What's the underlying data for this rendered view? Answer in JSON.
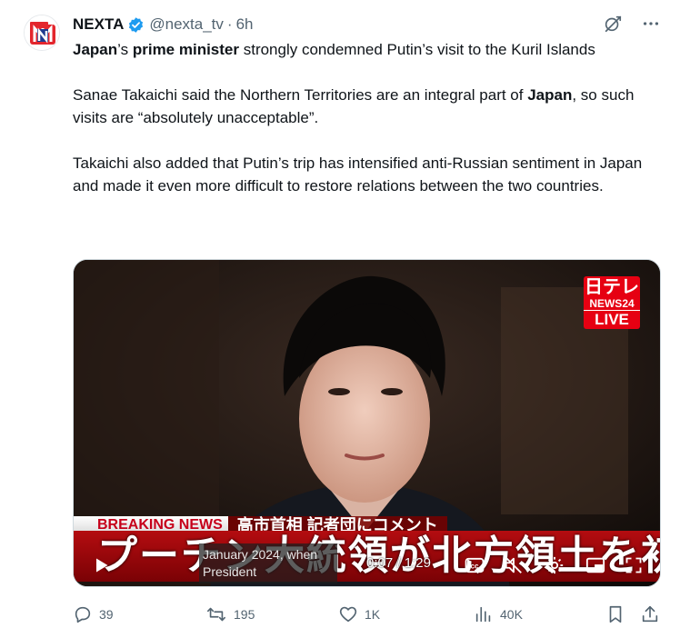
{
  "post": {
    "author_name": "NEXTA",
    "handle": "@nexta_tv",
    "separator": "·",
    "time": "6h",
    "avatar_icon": "nexta-logo",
    "verified_icon": "verified-badge-icon",
    "grok_icon": "grok-icon",
    "more_icon": "more-icon",
    "paragraph1": {
      "part1": "Japan",
      "part2": "’s ",
      "part3": "prime minister",
      "part4": " strongly condemned Putin’s visit to the Kuril Islands"
    },
    "paragraph2": {
      "part1": "Sanae Takaichi said the Northern Territories are an integral part of ",
      "part2": "Japan",
      "part3": ", so such visits are “absolutely unacceptable”."
    },
    "paragraph3": "Takaichi also added that Putin’s trip has intensified anti-Russian sentiment in Japan and made it even more difficult to restore relations between the two countries."
  },
  "video": {
    "logo_line1": "日テレ",
    "logo_line2": "NEWS24",
    "logo_line3": "LIVE",
    "breaking_label": "BREAKING NEWS",
    "subtitle_jp": "高市首相 記者団にコメント",
    "headline_jp": "プーチン大統領が北方領土を初訪問",
    "tooltip_line1": "January 2024, when",
    "tooltip_line2": "President",
    "current_time": "0:07",
    "time_separator": " / ",
    "duration": "1:29",
    "icons": [
      "play-icon",
      "cc-icon",
      "mute-icon",
      "settings-icon",
      "pip-icon",
      "fullscreen-icon"
    ]
  },
  "actions": {
    "replies": "39",
    "reposts": "195",
    "likes": "1K",
    "views": "40K",
    "icons": [
      "reply-icon",
      "repost-icon",
      "like-icon",
      "views-icon",
      "bookmark-icon",
      "share-icon"
    ]
  },
  "colors": {
    "text": "#0f1419",
    "secondary": "#536471",
    "verified": "#1d9bf0",
    "news_red": "#e60012"
  }
}
